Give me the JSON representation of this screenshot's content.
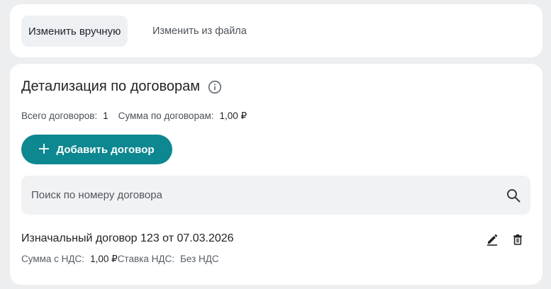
{
  "tabs": {
    "manual": "Изменить вручную",
    "from_file": "Изменить из файла"
  },
  "section": {
    "title": "Детализация по договорам",
    "total_label": "Всего договоров:",
    "total_value": "1",
    "sum_label": "Сумма по договорам:",
    "sum_value": "1,00 ₽"
  },
  "add_button": {
    "icon": "plus",
    "label": "Добавить договор"
  },
  "search": {
    "placeholder": "Поиск по номеру договора",
    "value": ""
  },
  "contracts": [
    {
      "title": "Изначальный договор 123 от 07.03.2026",
      "sum_label": "Сумма с НДС:",
      "sum_value": "1,00 ₽",
      "vat_label": "Ставка НДС:",
      "vat_value": "Без НДС"
    }
  ],
  "colors": {
    "accent": "#0d8790",
    "background": "#eceef0",
    "card": "#ffffff",
    "tab_active": "#eef1f4",
    "search_bg": "#f1f2f4"
  },
  "icons": {
    "info": "info-icon",
    "search": "search-icon",
    "edit": "pencil-icon",
    "delete": "trash-icon"
  }
}
